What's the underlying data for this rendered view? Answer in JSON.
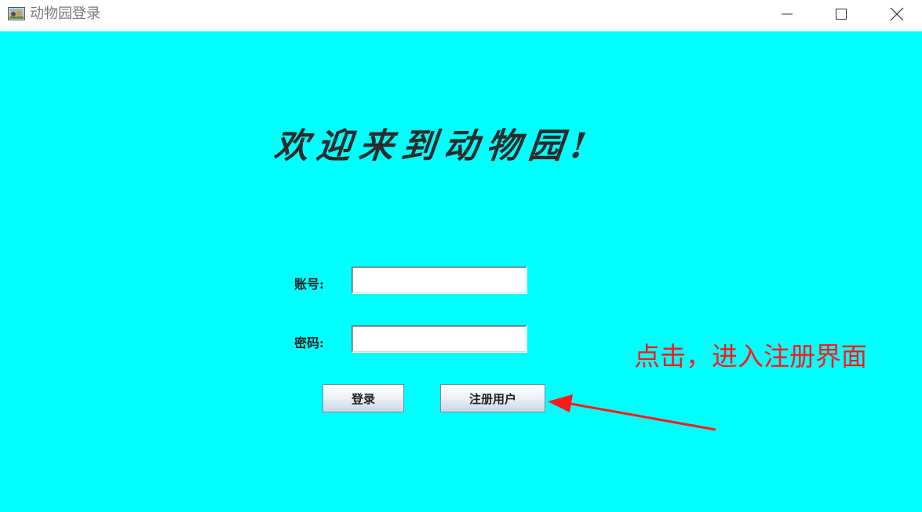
{
  "window": {
    "title": "动物园登录",
    "icon": "zoo-app-icon",
    "controls": {
      "minimize_icon": "minimize-icon",
      "maximize_icon": "maximize-icon",
      "close_icon": "close-icon"
    }
  },
  "main": {
    "welcome_text": "欢迎来到动物园!",
    "background_color": "#00ffff",
    "account_label": "账号:",
    "account_value": "",
    "password_label": "密码:",
    "password_value": "",
    "login_button": "登录",
    "register_button": "注册用户"
  },
  "annotation": {
    "text": "点击，进入注册界面",
    "color": "#ff1a1a",
    "arrow_icon": "red-arrow-icon"
  }
}
